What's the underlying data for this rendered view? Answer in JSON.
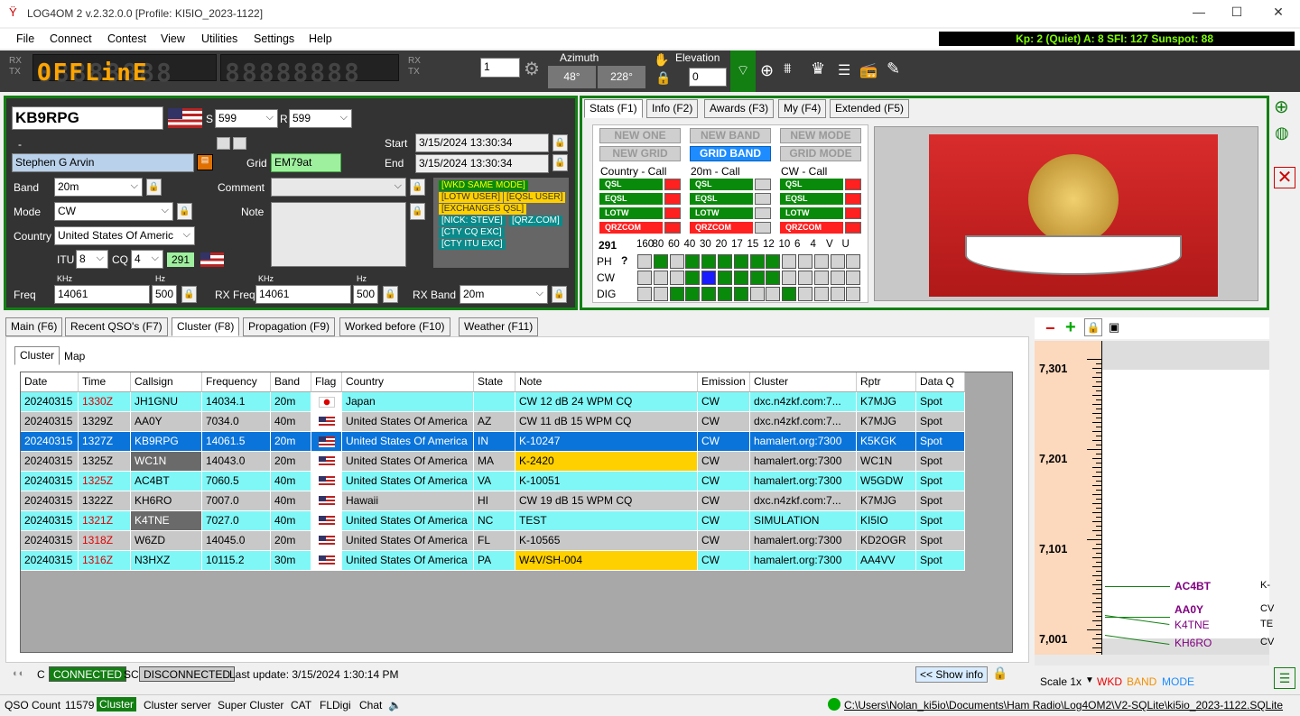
{
  "window": {
    "title": "LOG4OM 2 v.2.32.0.0 [Profile: KI5IO_2023-1122]"
  },
  "menu": [
    "File",
    "Connect",
    "Contest",
    "View",
    "Utilities",
    "Settings",
    "Help"
  ],
  "solar": "Kp: 2 (Quiet)  A: 8  SFI: 127  Sunspot: 88",
  "radio": {
    "rx": "RX",
    "tx": "TX",
    "display": "OFFLinE",
    "placeholder": "88888888",
    "step": "1",
    "azimuth_label": "Azimuth",
    "az1": "48°",
    "az2": "228°",
    "elevation_label": "Elevation",
    "elevation": "0"
  },
  "qso": {
    "callsign": "KB9RPG",
    "s_label": "S",
    "s_value": "599",
    "r_label": "R",
    "r_value": "599",
    "dash": "-",
    "name": "Stephen G Arvin",
    "grid_label": "Grid",
    "grid": "EM79at",
    "start_label": "Start",
    "start": "3/15/2024 13:30:34",
    "end_label": "End",
    "end": "3/15/2024 13:30:34",
    "band_label": "Band",
    "band": "20m",
    "comment_label": "Comment",
    "mode_label": "Mode",
    "mode": "CW",
    "note_label": "Note",
    "country_label": "Country",
    "country": "United States Of Americ",
    "itu_label": "ITU",
    "itu": "8",
    "cq_label": "CQ",
    "cq": "4",
    "dxcc": "291",
    "khz": "KHz",
    "hz": "Hz",
    "freq_label": "Freq",
    "freq": "14061",
    "freq_hz": "500",
    "rxfreq_label": "RX Freq",
    "rxfreq": "14061",
    "rxfreq_hz": "500",
    "rxband_label": "RX Band",
    "rxband": "20m",
    "tags": [
      "[WKD SAME MODE]",
      "[LOTW USER]",
      "[EQSL USER]",
      "[EXCHANGES QSL]",
      "[NICK: STEVE]",
      "[QRZ.COM]",
      "[CTY CQ EXC]",
      "[CTY ITU EXC]"
    ]
  },
  "stats": {
    "tabs": [
      "Stats (F1)",
      "Info (F2)",
      "Awards (F3)",
      "My (F4)",
      "Extended (F5)"
    ],
    "buttons": [
      "NEW ONE",
      "NEW BAND",
      "NEW MODE",
      "NEW GRID",
      "GRID BAND",
      "GRID MODE"
    ],
    "col_titles": [
      "Country - Call",
      "20m - Call",
      "CW - Call"
    ],
    "rows": [
      "QSL",
      "EQSL",
      "LOTW",
      "QRZCOM"
    ],
    "dxcc": "291",
    "help": "?",
    "bands": [
      "160",
      "80",
      "60",
      "40",
      "30",
      "20",
      "17",
      "15",
      "12",
      "10",
      "6",
      "4",
      "V",
      "U"
    ],
    "modes": [
      "PH",
      "CW",
      "DIG"
    ],
    "grid": [
      [
        0,
        1,
        0,
        1,
        1,
        1,
        1,
        1,
        1,
        0,
        0,
        0,
        0,
        0
      ],
      [
        0,
        0,
        0,
        1,
        2,
        1,
        1,
        1,
        1,
        0,
        0,
        0,
        0,
        0
      ],
      [
        0,
        0,
        1,
        1,
        1,
        1,
        1,
        0,
        0,
        1,
        0,
        0,
        0,
        0
      ]
    ]
  },
  "main_tabs": [
    "Main (F6)",
    "Recent QSO's (F7)",
    "Cluster (F8)",
    "Propagation (F9)",
    "Worked before (F10)",
    "Weather (F11)"
  ],
  "sub_tabs": [
    "Cluster",
    "Map"
  ],
  "columns": [
    "Date",
    "Time",
    "Callsign",
    "Frequency",
    "Band",
    "Flag",
    "Country",
    "State",
    "Note",
    "Emission",
    "Cluster",
    "Rptr",
    "Data Q"
  ],
  "spots": [
    {
      "date": "20240315",
      "time": "1330Z",
      "red": true,
      "call": "JH1GNU",
      "freq": "14034.1",
      "band": "20m",
      "flag": "jp",
      "country": "Japan",
      "state": "",
      "note": "CW 12 dB 24 WPM CQ",
      "em": "CW",
      "cluster": "dxc.n4zkf.com:7...",
      "rptr": "K7MJG",
      "dq": "Spot",
      "bg": "#7ff7f7"
    },
    {
      "date": "20240315",
      "time": "1329Z",
      "red": false,
      "call": "AA0Y",
      "freq": "7034.0",
      "band": "40m",
      "flag": "us",
      "country": "United States Of America",
      "state": "AZ",
      "note": "CW 11 dB 15 WPM CQ",
      "em": "CW",
      "cluster": "dxc.n4zkf.com:7...",
      "rptr": "K7MJG",
      "dq": "Spot",
      "bg": "#c8c8c8"
    },
    {
      "date": "20240315",
      "time": "1327Z",
      "red": false,
      "call": "KB9RPG",
      "freq": "14061.5",
      "band": "20m",
      "flag": "us",
      "country": "United States Of America",
      "state": "IN",
      "note": "K-10247",
      "em": "CW",
      "cluster": "hamalert.org:7300",
      "rptr": "K5KGK",
      "dq": "Spot",
      "bg": "#0a74da",
      "sel": true
    },
    {
      "date": "20240315",
      "time": "1325Z",
      "red": false,
      "call": "WC1N",
      "freq": "14043.0",
      "band": "20m",
      "flag": "us",
      "country": "United States Of America",
      "state": "MA",
      "note": "K-2420",
      "em": "CW",
      "cluster": "hamalert.org:7300",
      "rptr": "WC1N",
      "dq": "Spot",
      "bg": "#c8c8c8",
      "callbg": "#6a6a6a",
      "notebg": "#ffd000"
    },
    {
      "date": "20240315",
      "time": "1325Z",
      "red": true,
      "call": "AC4BT",
      "freq": "7060.5",
      "band": "40m",
      "flag": "us",
      "country": "United States Of America",
      "state": "VA",
      "note": "K-10051",
      "em": "CW",
      "cluster": "hamalert.org:7300",
      "rptr": "W5GDW",
      "dq": "Spot",
      "bg": "#7ff7f7"
    },
    {
      "date": "20240315",
      "time": "1322Z",
      "red": false,
      "call": "KH6RO",
      "freq": "7007.0",
      "band": "40m",
      "flag": "us",
      "country": "Hawaii",
      "state": "HI",
      "note": "CW 19 dB 15 WPM CQ",
      "em": "CW",
      "cluster": "dxc.n4zkf.com:7...",
      "rptr": "K7MJG",
      "dq": "Spot",
      "bg": "#c8c8c8"
    },
    {
      "date": "20240315",
      "time": "1321Z",
      "red": true,
      "call": "K4TNE",
      "freq": "7027.0",
      "band": "40m",
      "flag": "us",
      "country": "United States Of America",
      "state": "NC",
      "note": "TEST",
      "em": "CW",
      "cluster": "SIMULATION",
      "rptr": "KI5IO",
      "dq": "Spot",
      "bg": "#7ff7f7",
      "callbg": "#6a6a6a"
    },
    {
      "date": "20240315",
      "time": "1318Z",
      "red": true,
      "call": "W6ZD",
      "freq": "14045.0",
      "band": "20m",
      "flag": "us",
      "country": "United States Of America",
      "state": "FL",
      "note": "K-10565",
      "em": "CW",
      "cluster": "hamalert.org:7300",
      "rptr": "KD2OGR",
      "dq": "Spot",
      "bg": "#c8c8c8"
    },
    {
      "date": "20240315",
      "time": "1316Z",
      "red": true,
      "call": "N3HXZ",
      "freq": "10115.2",
      "band": "30m",
      "flag": "us",
      "country": "United States Of America",
      "state": "PA",
      "note": "W4V/SH-004",
      "em": "CW",
      "cluster": "hamalert.org:7300",
      "rptr": "AA4VV",
      "dq": "Spot",
      "bg": "#7ff7f7",
      "notebg": "#ffd000"
    }
  ],
  "cluster_status": {
    "c": "C",
    "connected": "CONNECTED",
    "sc": "SC",
    "disconnected": "DISCONNECTED",
    "last_update": "Last update:  3/15/2024 1:30:14 PM",
    "show_info": "<< Show info"
  },
  "bandmap": {
    "ticks": [
      "7,301",
      "7,201",
      "7,101",
      "7,001"
    ],
    "spots": [
      {
        "call": "AC4BT",
        "text": "K-",
        "color": "#800080"
      },
      {
        "call": "AA0Y",
        "text": "CV",
        "color": "#800080"
      },
      {
        "call": "K4TNE",
        "text": "TE",
        "color": "#800080"
      },
      {
        "call": "KH6RO",
        "text": "CV",
        "color": "#800080"
      }
    ],
    "scale": "Scale 1x",
    "wkd": "WKD",
    "band": "BAND",
    "mode": "MODE"
  },
  "statusbar": {
    "qso_count_label": "QSO Count",
    "qso_count": "11579",
    "cluster": "Cluster",
    "cluster_server": "Cluster server",
    "super_cluster": "Super Cluster",
    "cat": "CAT",
    "fldigi": "FLDigi",
    "chat": "Chat",
    "path": "C:\\Users\\Nolan_ki5io\\Documents\\Ham Radio\\Log4OM2\\V2-SQLite\\ki5io_2023-1122.SQLite"
  },
  "colors": {
    "green_border": "#137f13",
    "cyan_row": "#7ff7f7",
    "gray_row": "#c8c8c8",
    "selected": "#0a74da",
    "yellow_note": "#ffd000"
  }
}
